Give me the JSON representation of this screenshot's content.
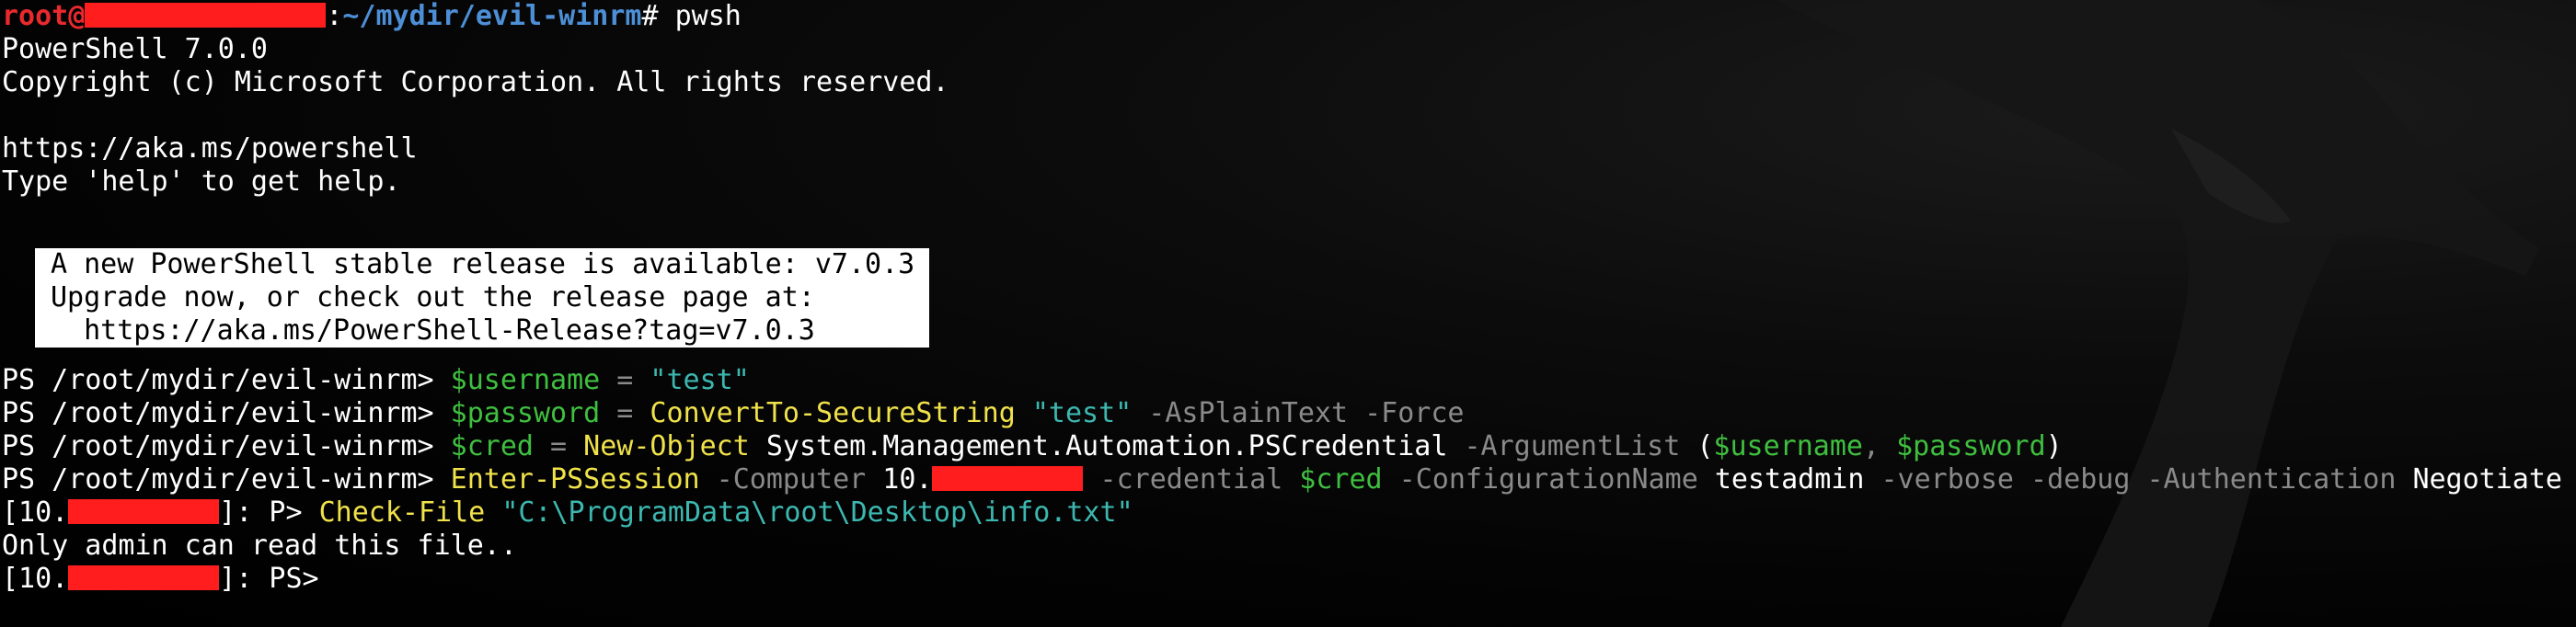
{
  "prompt1": {
    "user": "root@",
    "sep": ":",
    "path": "~/mydir/evil-winrm",
    "symbol": "# ",
    "command": "pwsh"
  },
  "banner": {
    "version": "PowerShell 7.0.0",
    "copyright": "Copyright (c) Microsoft Corporation. All rights reserved.",
    "url": "https://aka.ms/powershell",
    "help": "Type 'help' to get help."
  },
  "notice": {
    "line1": "A new PowerShell stable release is available: v7.0.3",
    "line2": "Upgrade now, or check out the release page at:",
    "line3": "  https://aka.ms/PowerShell-Release?tag=v7.0.3"
  },
  "ps_prompt": "PS /root/mydir/evil-winrm> ",
  "cmd1": {
    "var": "$username",
    "eq": " = ",
    "str": "\"test\""
  },
  "cmd2": {
    "var": "$password",
    "eq": " = ",
    "cmdlet": "ConvertTo-SecureString",
    "sp": " ",
    "str": "\"test\"",
    "params": " -AsPlainText -Force"
  },
  "cmd3": {
    "var": "$cred",
    "eq": " = ",
    "cmdlet": "New-Object",
    "type": " System.Management.Automation.PSCredential",
    "param": " -ArgumentList ",
    "open": "(",
    "arg1": "$username",
    "comma": ", ",
    "arg2": "$password",
    "close": ")"
  },
  "cmd4": {
    "cmdlet": "Enter-PSSession",
    "p_computer": " -Computer ",
    "ip_prefix": "10.",
    "p_cred": " -credential ",
    "cred_var": "$cred",
    "p_config": " -ConfigurationName ",
    "config": "testadmin",
    "p_flags": " -verbose -debug -Authentication ",
    "auth": "Negotiate"
  },
  "remote1": {
    "open": "[10.",
    "suffix": "]: P> ",
    "cmdlet": "Check-File",
    "sp": " ",
    "str": "\"C:\\ProgramData\\root\\Desktop\\info.txt\""
  },
  "output": "Only admin can read this file..",
  "remote2": {
    "open": "[10.",
    "suffix": "]: PS>"
  },
  "colors": {
    "background": "#000000",
    "prompt_user": "#e8292d",
    "prompt_path": "#4d8fd6",
    "variable": "#3fbf3f",
    "string": "#3cb8b0",
    "cmdlet": "#f0e24a",
    "parameter": "#8a8a8a",
    "redaction": "#ff1d1d"
  }
}
